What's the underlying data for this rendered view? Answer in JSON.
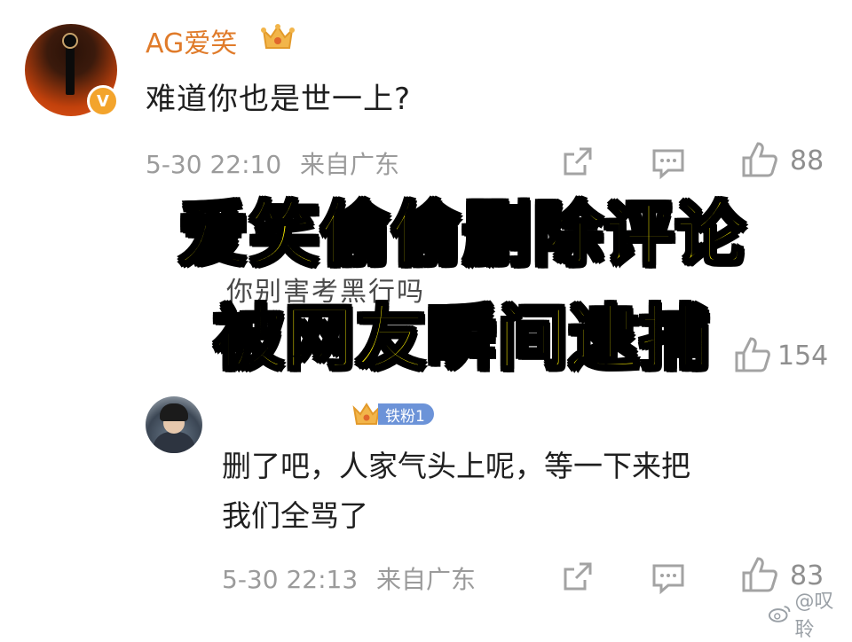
{
  "comment1": {
    "username": "AG爱笑",
    "verified_mark": "V",
    "text": "难道你也是世一上?",
    "date": "5-30 22:10",
    "location": "来自广东",
    "likes": "88"
  },
  "overlay": {
    "line1": "爱笑偷偷删除评论",
    "line2": "被网友瞬间逮捕"
  },
  "comment2": {
    "partial_text": "你别害考黑行吗",
    "likes": "154"
  },
  "comment3": {
    "fan_badge": "铁粉1",
    "text_line1": "删了吧，人家气头上呢，等一下来把",
    "text_line2": "我们全骂了",
    "date": "5-30 22:13",
    "location": "来自广东",
    "likes": "83"
  },
  "watermark": {
    "text": "@叹聆",
    "icon": "weibo-icon"
  },
  "colors": {
    "username": "#e07b2a",
    "meta": "#9b9b9b",
    "banner_fill": "#fff200",
    "fan_tag": "#6c93d8"
  }
}
